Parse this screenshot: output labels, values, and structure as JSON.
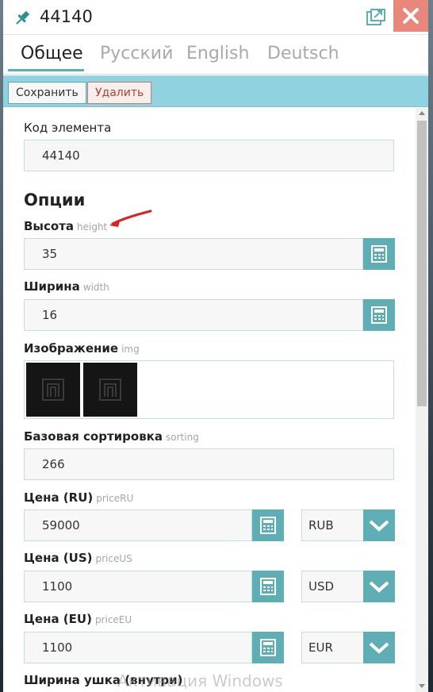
{
  "window": {
    "title": "44140",
    "close_label": "✕"
  },
  "tabs": [
    {
      "label": "Общее",
      "active": true
    },
    {
      "label": "Русский",
      "active": false
    },
    {
      "label": "English",
      "active": false
    },
    {
      "label": "Deutsch",
      "active": false
    }
  ],
  "toolbar": {
    "save_label": "Сохранить",
    "delete_label": "Удалить"
  },
  "form": {
    "code_label": "Код элемента",
    "code_value": "44140",
    "options_title": "Опции",
    "height_label": "Высота",
    "height_hint": "height",
    "height_value": "35",
    "width_label": "Ширина",
    "width_hint": "width",
    "width_value": "16",
    "image_label": "Изображение",
    "image_hint": "img",
    "sorting_label": "Базовая сортировка",
    "sorting_hint": "sorting",
    "sorting_value": "266",
    "price_ru_label": "Цена (RU)",
    "price_ru_hint": "priceRU",
    "price_ru_value": "59000",
    "price_ru_currency": "RUB",
    "price_us_label": "Цена (US)",
    "price_us_hint": "priceUS",
    "price_us_value": "1100",
    "price_us_currency": "USD",
    "price_eu_label": "Цена (EU)",
    "price_eu_hint": "priceEU",
    "price_eu_value": "1100",
    "price_eu_currency": "EUR",
    "ear_width_label": "Ширина ушка (внутри)"
  },
  "overlay": {
    "watermark": "Активация Windows"
  },
  "colors": {
    "accent": "#5faeb5",
    "toolbar_bg": "#8ed3df",
    "close_bg": "#e8877b",
    "delete_text": "#c0392b",
    "annotation_arrow": "#e02020"
  },
  "icons": {
    "pin": "pin-icon",
    "popout": "popout-icon",
    "close": "close-icon",
    "calculator": "calculator-icon",
    "dropdown": "chevron-down-icon"
  }
}
